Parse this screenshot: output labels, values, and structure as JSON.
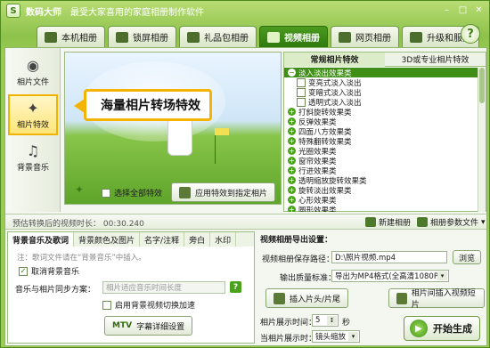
{
  "app": {
    "name": "数码大师",
    "slogan": "最受大家喜用的家庭相册制作软件"
  },
  "window_controls": [
    "minimize",
    "maximize",
    "close"
  ],
  "tabs": [
    {
      "label": "本机相册",
      "active": false
    },
    {
      "label": "锁屏相册",
      "active": false
    },
    {
      "label": "礼品包相册",
      "active": false
    },
    {
      "label": "视频相册",
      "active": true
    },
    {
      "label": "网页相册",
      "active": false
    },
    {
      "label": "升级和服务",
      "active": false
    }
  ],
  "help_label": "?",
  "sidebar": {
    "items": [
      {
        "label": "相片文件",
        "icon": "camera-icon",
        "active": false
      },
      {
        "label": "相片特效",
        "icon": "sparkle-icon",
        "active": true
      },
      {
        "label": "背景音乐",
        "icon": "music-note-icon",
        "active": false
      }
    ]
  },
  "preview": {
    "callout": "海量相片转场特效"
  },
  "controls": {
    "select_all_label": "选择全部特效",
    "select_all_checked": false,
    "apply_label": "应用特效到指定相片"
  },
  "effects": {
    "tabs": [
      {
        "label": "常规相片特效",
        "active": true
      },
      {
        "label": "3D或专业相片特效",
        "active": false
      }
    ],
    "tree": [
      {
        "label": "淡入淡出效果类",
        "type": "group",
        "expanded": true,
        "selected": true
      },
      {
        "label": "变亮式淡入淡出",
        "type": "child"
      },
      {
        "label": "变暗式淡入淡出",
        "type": "child"
      },
      {
        "label": "透明式淡入淡出",
        "type": "child"
      },
      {
        "label": "打斜旋转效果类",
        "type": "group"
      },
      {
        "label": "反弹效果类",
        "type": "group"
      },
      {
        "label": "四面八方效果类",
        "type": "group"
      },
      {
        "label": "特殊翻转效果类",
        "type": "group"
      },
      {
        "label": "光圈效果类",
        "type": "group"
      },
      {
        "label": "窗帘效果类",
        "type": "group"
      },
      {
        "label": "行进效果类",
        "type": "group"
      },
      {
        "label": "透明缩放旋转效果类",
        "type": "group"
      },
      {
        "label": "旋转淡出效果类",
        "type": "group"
      },
      {
        "label": "心形效果类",
        "type": "group"
      },
      {
        "label": "圆形效果类",
        "type": "group"
      }
    ]
  },
  "status": {
    "length_label": "预估转换后的视频时长：",
    "length_value": "00:30.240",
    "new_album_label": "新建相册",
    "params_label": "相册参数文件"
  },
  "bottom_tabs": [
    {
      "label": "背景音乐及歌词",
      "active": true
    },
    {
      "label": "背景颜色及图片",
      "active": false
    },
    {
      "label": "名字/注释",
      "active": false
    },
    {
      "label": "旁白",
      "active": false
    },
    {
      "label": "水印",
      "active": false
    }
  ],
  "music": {
    "note": "注：歌词文件请在“背景音乐”中插入。",
    "cancel_music_label": "取消背景音乐",
    "cancel_music_checked": true,
    "sync_label": "音乐与相片同步方案：",
    "sync_value": "相片适应音乐时间长度",
    "bg_video_label": "启用背景视频切换加速",
    "bg_video_checked": false,
    "mtv_label": "MTV",
    "subtitle_label": "字幕详细设置"
  },
  "export": {
    "title": "视频相册导出设置：",
    "path_label": "视频相册保存路径：",
    "path_value": "D:\\照片视频.mp4",
    "browse_label": "浏览",
    "quality_label": "输出质量标准：",
    "quality_value": "导出为MP4格式(全高清1080P)",
    "insert_clip_label": "插入片头/片尾",
    "insert_video_label": "相片间插入视频短片",
    "show_time_label": "相片展示时间：",
    "show_time_value": "5",
    "show_time_unit": "秒",
    "show_mode_label": "当相片展示时：",
    "show_mode_value": "镜头缩放",
    "generate_label": "开始生成"
  }
}
